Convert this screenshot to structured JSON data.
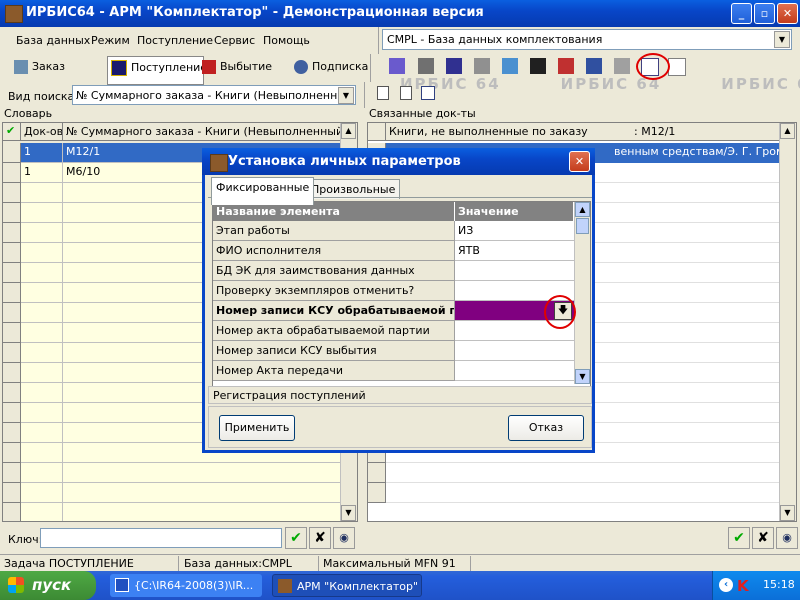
{
  "window": {
    "title": "ИРБИС64 - АРМ \"Комплектатор\" - Демонстрационная версия"
  },
  "menu": [
    "База данных",
    "Режим",
    "Поступление",
    "Сервис",
    "Помощь"
  ],
  "db_combo": {
    "value": "CMPL - База данных комплектования"
  },
  "mode_tabs": [
    {
      "label": "Заказ"
    },
    {
      "label": "Поступление"
    },
    {
      "label": "Выбытие"
    },
    {
      "label": "Подписка"
    }
  ],
  "watermark": "ИРБИС 64",
  "search": {
    "label": "Вид поиска",
    "value": "№ Суммарного заказа - Книги (Невыполненный зак"
  },
  "dictionary": {
    "label": "Словарь",
    "columns": [
      "Док-ов",
      "№ Суммарного заказа - Книги (Невыполненный заказ"
    ],
    "rows": [
      {
        "count": "1",
        "value": "M12/1",
        "selected": true
      },
      {
        "count": "1",
        "value": "M6/10",
        "selected": false
      }
    ]
  },
  "linked_docs": {
    "label": "Связанные док-ты",
    "header": "Книги, не выполненные по заказу",
    "header_value": ": M12/1",
    "first_row_tail": "венным средствам/Э. Г. Громов"
  },
  "key": {
    "label": "Ключ:",
    "value": ""
  },
  "status": {
    "task": "Задача ПОСТУПЛЕНИЕ",
    "db": "База данных:CMPL",
    "mfn": "Максимальный MFN 91"
  },
  "taskbar": {
    "start": "пуск",
    "tasks": [
      {
        "label": "{C:\\IR64-2008(3)\\IR..."
      },
      {
        "label": "АРМ \"Комплектатор\""
      }
    ],
    "clock": "15:18"
  },
  "dialog": {
    "title": "Установка личных параметров",
    "tabs": [
      "Фиксированные",
      "Произвольные"
    ],
    "columns": [
      "Название элемента",
      "Значение"
    ],
    "rows": [
      {
        "name": "Этап работы",
        "value": "ИЗ"
      },
      {
        "name": "ФИО исполнителя",
        "value": "ЯТВ"
      },
      {
        "name": "БД ЭК для заимствования данных",
        "value": ""
      },
      {
        "name": "Проверку экземпляров отменить?",
        "value": ""
      },
      {
        "name": "Номер записи КСУ обрабатываемой партии",
        "value": ""
      },
      {
        "name": "Номер акта обрабатываемой партии",
        "value": ""
      },
      {
        "name": "Номер записи КСУ выбытия",
        "value": ""
      },
      {
        "name": "Номер Акта передачи",
        "value": ""
      }
    ],
    "info": "Регистрация поступлений",
    "apply": "Применить",
    "cancel": "Отказ"
  },
  "colors": {
    "xp_blue": "#0846C8",
    "selection": "#316AC5",
    "grid_bg": "#FFFFE1",
    "active_cell": "#800080",
    "highlight_circle": "#E00000"
  }
}
